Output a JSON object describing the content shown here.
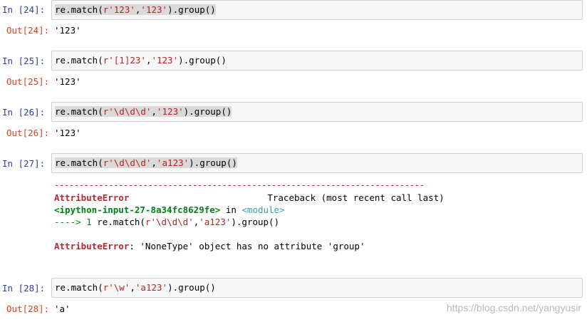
{
  "cells": [
    {
      "in_prompt": "In  [24]:",
      "code_pre": "re.match(",
      "code_str1": "r'123'",
      "code_mid": ",",
      "code_str2": "'123'",
      "code_post": ").group()",
      "out_prompt": "Out[24]:",
      "output": "'123'"
    },
    {
      "in_prompt": "In  [25]:",
      "code_pre": "re.match(",
      "code_str1": "r'[1]23'",
      "code_mid": ",",
      "code_str2": "'123'",
      "code_post": ").group()",
      "out_prompt": "Out[25]:",
      "output": "'123'"
    },
    {
      "in_prompt": "In  [26]:",
      "code_pre": "re.match(",
      "code_str1": "r'\\d\\d\\d'",
      "code_mid": ",",
      "code_str2": "'123'",
      "code_post": ").group()",
      "out_prompt": "Out[26]:",
      "output": "'123'"
    },
    {
      "in_prompt": "In  [27]:",
      "code_pre": "re.match(",
      "code_str1": "r'\\d\\d\\d'",
      "code_mid": ",",
      "code_str2": "'a123'",
      "code_post": ").group()"
    },
    {
      "in_prompt": "In  [28]:",
      "code_pre": "re.match(",
      "code_str1": "r'\\w'",
      "code_mid": ",",
      "code_str2": "'a123'",
      "code_post": ").group()",
      "out_prompt": "Out[28]:",
      "output": "'a'"
    }
  ],
  "traceback": {
    "dashes": "---------------------------------------------------------------------------",
    "error_name": "AttributeError",
    "traceback_label": "Traceback (most recent call last)",
    "input_ref": "<ipython-input-27-8a34fc8629fe>",
    "in_word": " in ",
    "module": "<module>",
    "arrow": "----> 1 ",
    "line_code_pre": "re.match(",
    "line_str1": "r'\\d\\d\\d'",
    "line_mid": ",",
    "line_str2": "'a123'",
    "line_post": ").group()",
    "error_msg_name": "AttributeError",
    "error_msg": ": 'NoneType' object has no attribute 'group'"
  },
  "watermark": "https://blog.csdn.net/yangyusir"
}
